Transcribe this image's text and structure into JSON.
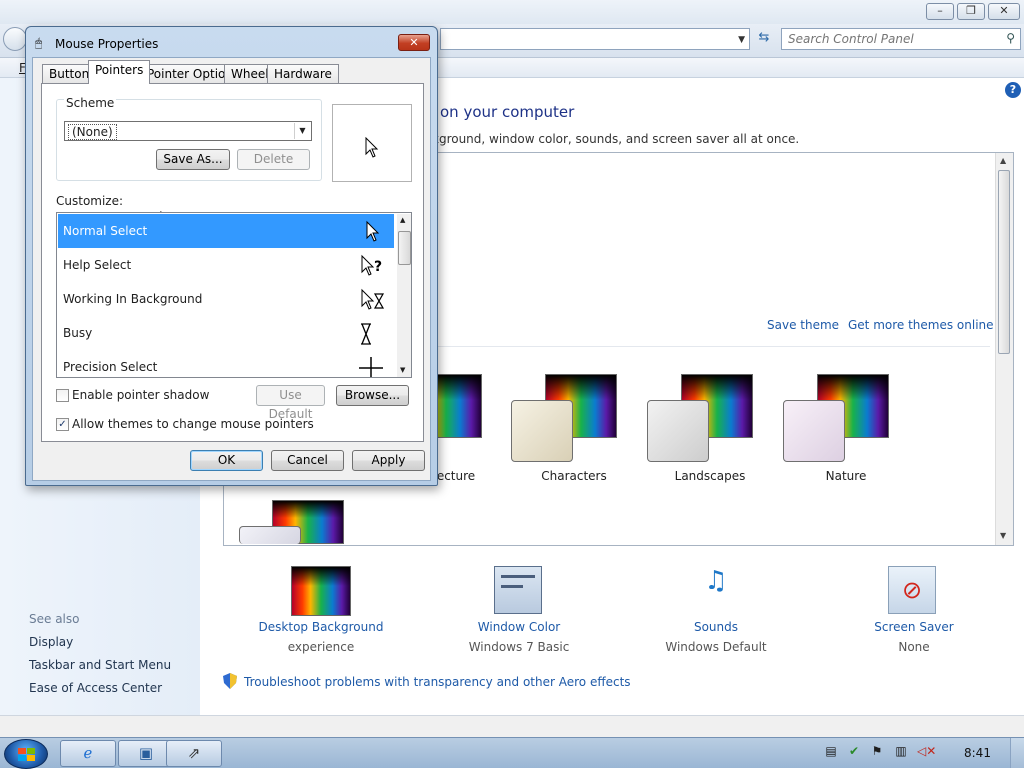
{
  "control_panel": {
    "search_placeholder": "Search Control Panel",
    "menu_fragment": "F",
    "heading": "on your computer",
    "subheading": "kground, window color, sounds, and screen saver all at once.",
    "save_theme": "Save theme",
    "get_more_themes": "Get more themes online",
    "themes": [
      {
        "label": "ecture"
      },
      {
        "label": "Characters"
      },
      {
        "label": "Landscapes"
      },
      {
        "label": "Nature"
      }
    ],
    "bottom_items": [
      {
        "title": "Desktop Background",
        "subtitle": "experience"
      },
      {
        "title": "Window Color",
        "subtitle": "Windows 7 Basic"
      },
      {
        "title": "Sounds",
        "subtitle": "Windows Default"
      },
      {
        "title": "Screen Saver",
        "subtitle": "None"
      }
    ],
    "troubleshoot_link": "Troubleshoot problems with transparency and other Aero effects",
    "see_also": "See also",
    "left_links": [
      "Display",
      "Taskbar and Start Menu",
      "Ease of Access Center"
    ]
  },
  "dialog": {
    "title": "Mouse Properties",
    "close_glyph": "✕",
    "tabs": [
      "Buttons",
      "Pointers",
      "Pointer Options",
      "Wheel",
      "Hardware"
    ],
    "active_tab": "Pointers",
    "scheme_label": "Scheme",
    "scheme_value": "(None)",
    "save_as": "Save As...",
    "delete": "Delete",
    "customize_label": "Customize:",
    "cursors": [
      {
        "label": "Normal Select",
        "glyph": "arrow-cursor-icon",
        "selected": true
      },
      {
        "label": "Help Select",
        "glyph": "help-cursor-icon"
      },
      {
        "label": "Working In Background",
        "glyph": "working-cursor-icon"
      },
      {
        "label": "Busy",
        "glyph": "hourglass-icon"
      },
      {
        "label": "Precision Select",
        "glyph": "crosshair-icon"
      }
    ],
    "enable_shadow": "Enable pointer shadow",
    "enable_shadow_checked": false,
    "allow_themes": "Allow themes to change mouse pointers",
    "allow_themes_checked": true,
    "use_default": "Use Default",
    "browse": "Browse...",
    "ok": "OK",
    "cancel": "Cancel",
    "apply": "Apply"
  },
  "taskbar": {
    "clock": "8:41"
  }
}
